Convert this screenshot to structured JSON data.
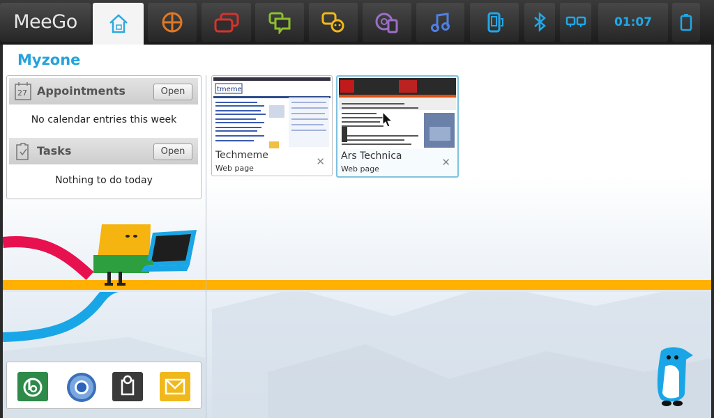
{
  "topbar": {
    "logo": "MeeGo",
    "clock": "01:07",
    "icons": [
      "home-icon",
      "apps-icon",
      "windows-icon",
      "chat-icon",
      "people-icon",
      "media-icon",
      "music-icon",
      "devices-icon",
      "bluetooth-icon",
      "network-icon",
      "battery-icon"
    ]
  },
  "myzone": {
    "title": "Myzone",
    "appointments": {
      "label": "Appointments",
      "date_badge": "27",
      "open_label": "Open",
      "message": "No calendar entries this week"
    },
    "tasks": {
      "label": "Tasks",
      "open_label": "Open",
      "message": "Nothing to do today"
    }
  },
  "recent": [
    {
      "title": "Techmeme",
      "type": "Web page",
      "logo_text": "tmeme"
    },
    {
      "title": "Ars Technica",
      "type": "Web page"
    }
  ],
  "dock": {
    "apps": [
      "bookmark-app-icon",
      "chromium-icon",
      "settings-tag-icon",
      "email-icon"
    ]
  },
  "colors": {
    "accent": "#25a2da",
    "clock": "#1fa8e8",
    "stripe_orange": "#ffb000",
    "stripe_pink": "#e8114f",
    "stripe_blue": "#19a6e6"
  }
}
